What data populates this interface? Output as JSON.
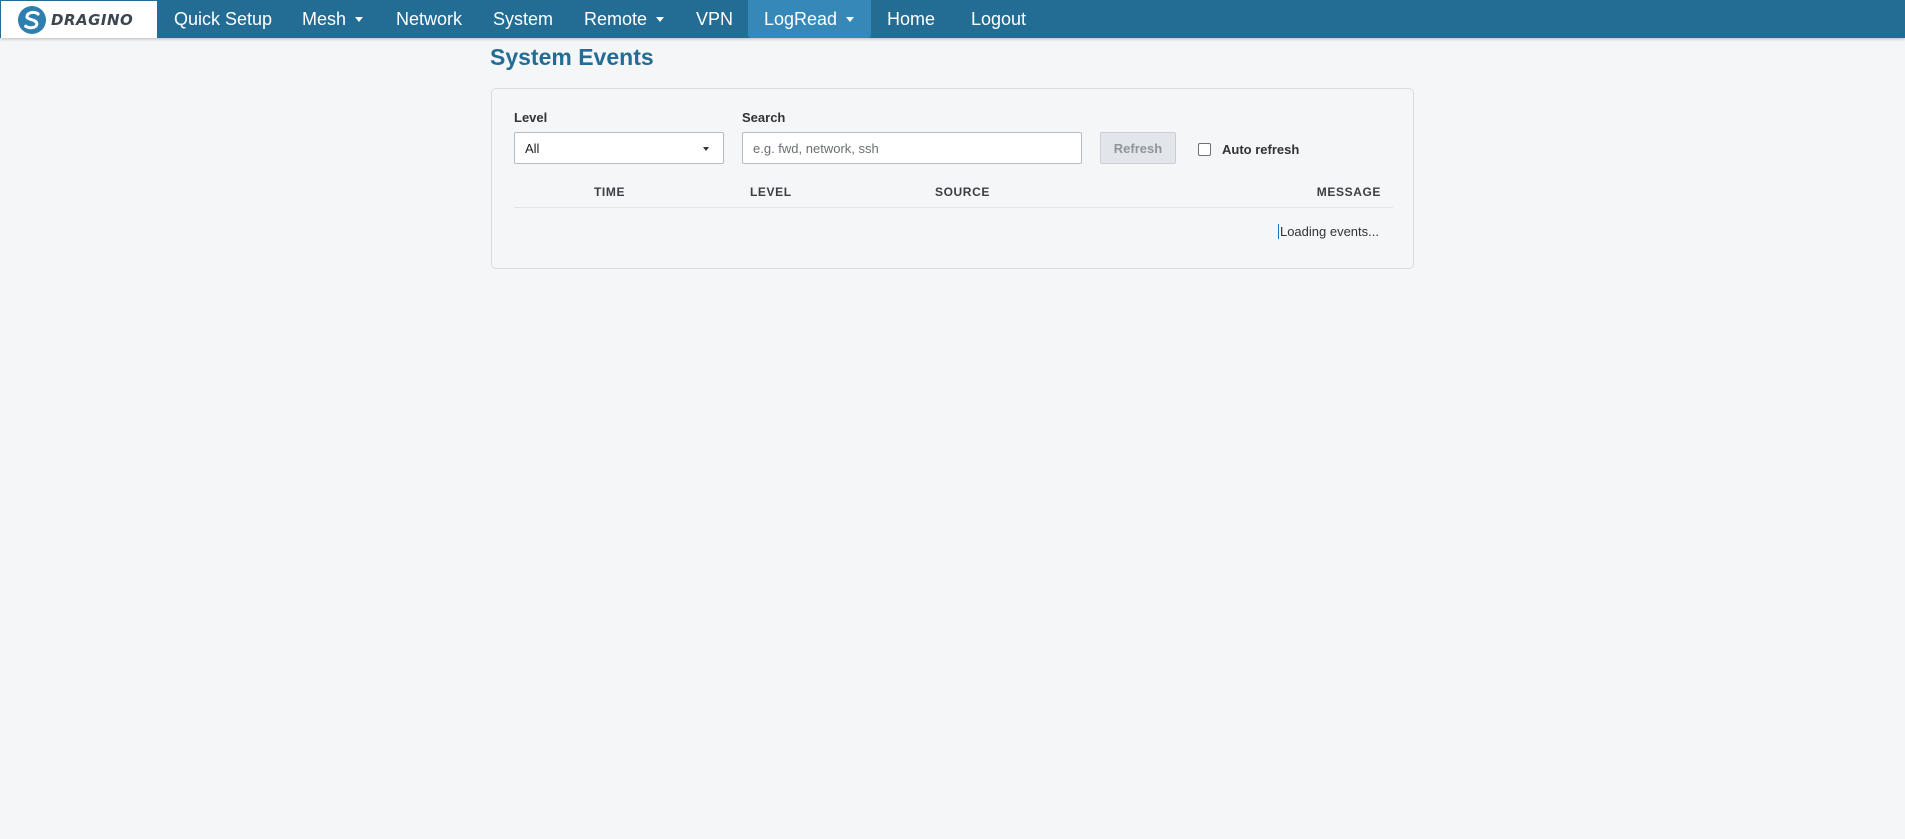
{
  "brand": {
    "name": "DRAGINO",
    "logo_icon": "dragino-swirl-logo-icon",
    "logo_color": "#2e7fb0"
  },
  "nav": {
    "items": [
      {
        "label": "Quick Setup",
        "has_dropdown": false,
        "active": false
      },
      {
        "label": "Mesh",
        "has_dropdown": true,
        "active": false
      },
      {
        "label": "Network",
        "has_dropdown": false,
        "active": false
      },
      {
        "label": "System",
        "has_dropdown": false,
        "active": false
      },
      {
        "label": "Remote",
        "has_dropdown": true,
        "active": false
      },
      {
        "label": "VPN",
        "has_dropdown": false,
        "active": false
      },
      {
        "label": "LogRead",
        "has_dropdown": true,
        "active": true
      },
      {
        "label": "Home",
        "has_dropdown": false,
        "active": false
      },
      {
        "label": "Logout",
        "has_dropdown": false,
        "active": false
      }
    ]
  },
  "page": {
    "title": "System Events"
  },
  "filters": {
    "level_label": "Level",
    "level_value": "All",
    "search_label": "Search",
    "search_value": "",
    "search_placeholder": "e.g. fwd, network, ssh",
    "refresh_label": "Refresh",
    "auto_refresh_label": "Auto refresh",
    "auto_refresh_checked": false
  },
  "table": {
    "columns": [
      "TIME",
      "LEVEL",
      "SOURCE",
      "MESSAGE"
    ],
    "loading_text": "Loading events..."
  },
  "colors": {
    "navbar": "#236c94",
    "nav_active": "#3588b8",
    "title": "#236c94",
    "background": "#f4f6f8"
  }
}
